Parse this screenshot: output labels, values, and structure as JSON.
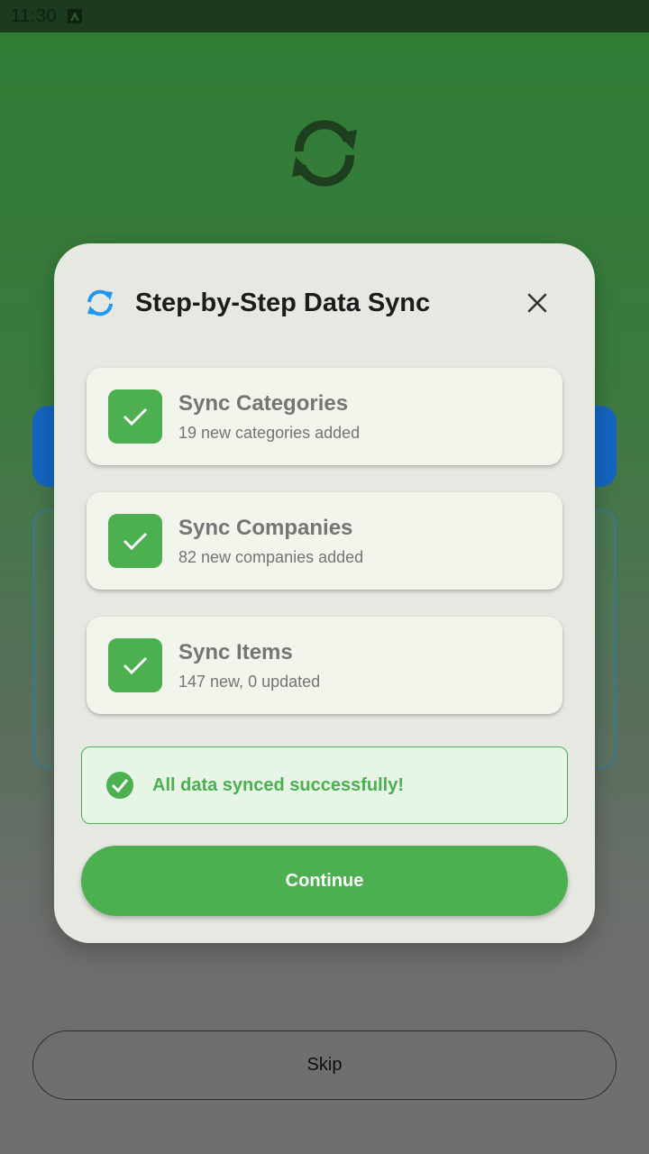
{
  "status_bar": {
    "time": "11:30",
    "notification_icon": "a-notification-icon"
  },
  "background": {
    "sync_icon": "sync-icon",
    "skip_label": "Skip"
  },
  "dialog": {
    "title": "Step-by-Step Data Sync",
    "header_icon": "sync-icon",
    "close_icon": "close-icon",
    "steps": [
      {
        "title": "Sync Categories",
        "subtitle": "19 new categories added",
        "status": "done"
      },
      {
        "title": "Sync Companies",
        "subtitle": "82 new companies added",
        "status": "done"
      },
      {
        "title": "Sync Items",
        "subtitle": "147 new, 0 updated",
        "status": "done"
      }
    ],
    "success_message": "All data synced successfully!",
    "continue_label": "Continue"
  },
  "colors": {
    "accent_green": "#4caf50",
    "accent_blue": "#2196f3",
    "dialog_bg": "#e6e9e2"
  }
}
